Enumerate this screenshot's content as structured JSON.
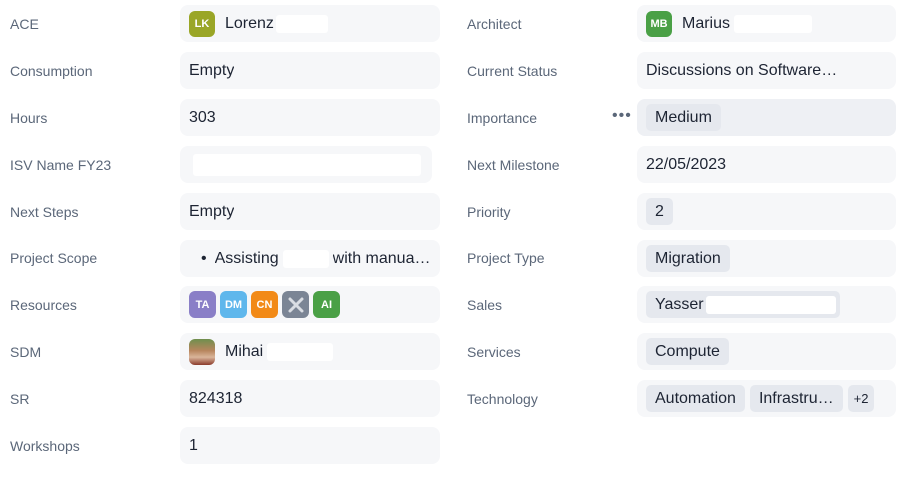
{
  "left_fields": {
    "ace": {
      "label": "ACE",
      "initials": "LK",
      "name": "Lorenz"
    },
    "consumption": {
      "label": "Consumption",
      "value": "Empty"
    },
    "hours": {
      "label": "Hours",
      "value": "303"
    },
    "isv_name": {
      "label": "ISV Name FY23",
      "value": ""
    },
    "next_steps": {
      "label": "Next Steps",
      "value": "Empty"
    },
    "project_scope": {
      "label": "Project Scope",
      "bullet": "•",
      "text_start": "Assisting",
      "text_end": "with manua…"
    },
    "resources": {
      "label": "Resources",
      "avatars": [
        "TA",
        "DM",
        "CN",
        "",
        "AI"
      ]
    },
    "sdm": {
      "label": "SDM",
      "name": "Mihai"
    },
    "sr": {
      "label": "SR",
      "value": "824318"
    },
    "workshops": {
      "label": "Workshops",
      "value": "1"
    }
  },
  "right_fields": {
    "architect": {
      "label": "Architect",
      "initials": "MB",
      "name": "Marius"
    },
    "current_status": {
      "label": "Current Status",
      "value": "Discussions on Software…"
    },
    "importance": {
      "label": "Importance",
      "value": "Medium",
      "menu": "•••"
    },
    "next_milestone": {
      "label": "Next Milestone",
      "value": "22/05/2023"
    },
    "priority": {
      "label": "Priority",
      "value": "2"
    },
    "project_type": {
      "label": "Project Type",
      "value": "Migration"
    },
    "sales": {
      "label": "Sales",
      "value": "Yasser"
    },
    "services": {
      "label": "Services",
      "value": "Compute"
    },
    "technology": {
      "label": "Technology",
      "tags": [
        "Automation",
        "Infrastru…"
      ],
      "more": "+2"
    }
  },
  "colors": {
    "LK": "#9aa627",
    "MB": "#4aa046",
    "TA": "#8a7fc7",
    "DM": "#5fb7ec",
    "CN": "#f28a17",
    "X": "#7b8595",
    "AI": "#4aa046"
  },
  "icons": {
    "removed_resource": "close-icon",
    "menu": "more-dots-icon"
  }
}
